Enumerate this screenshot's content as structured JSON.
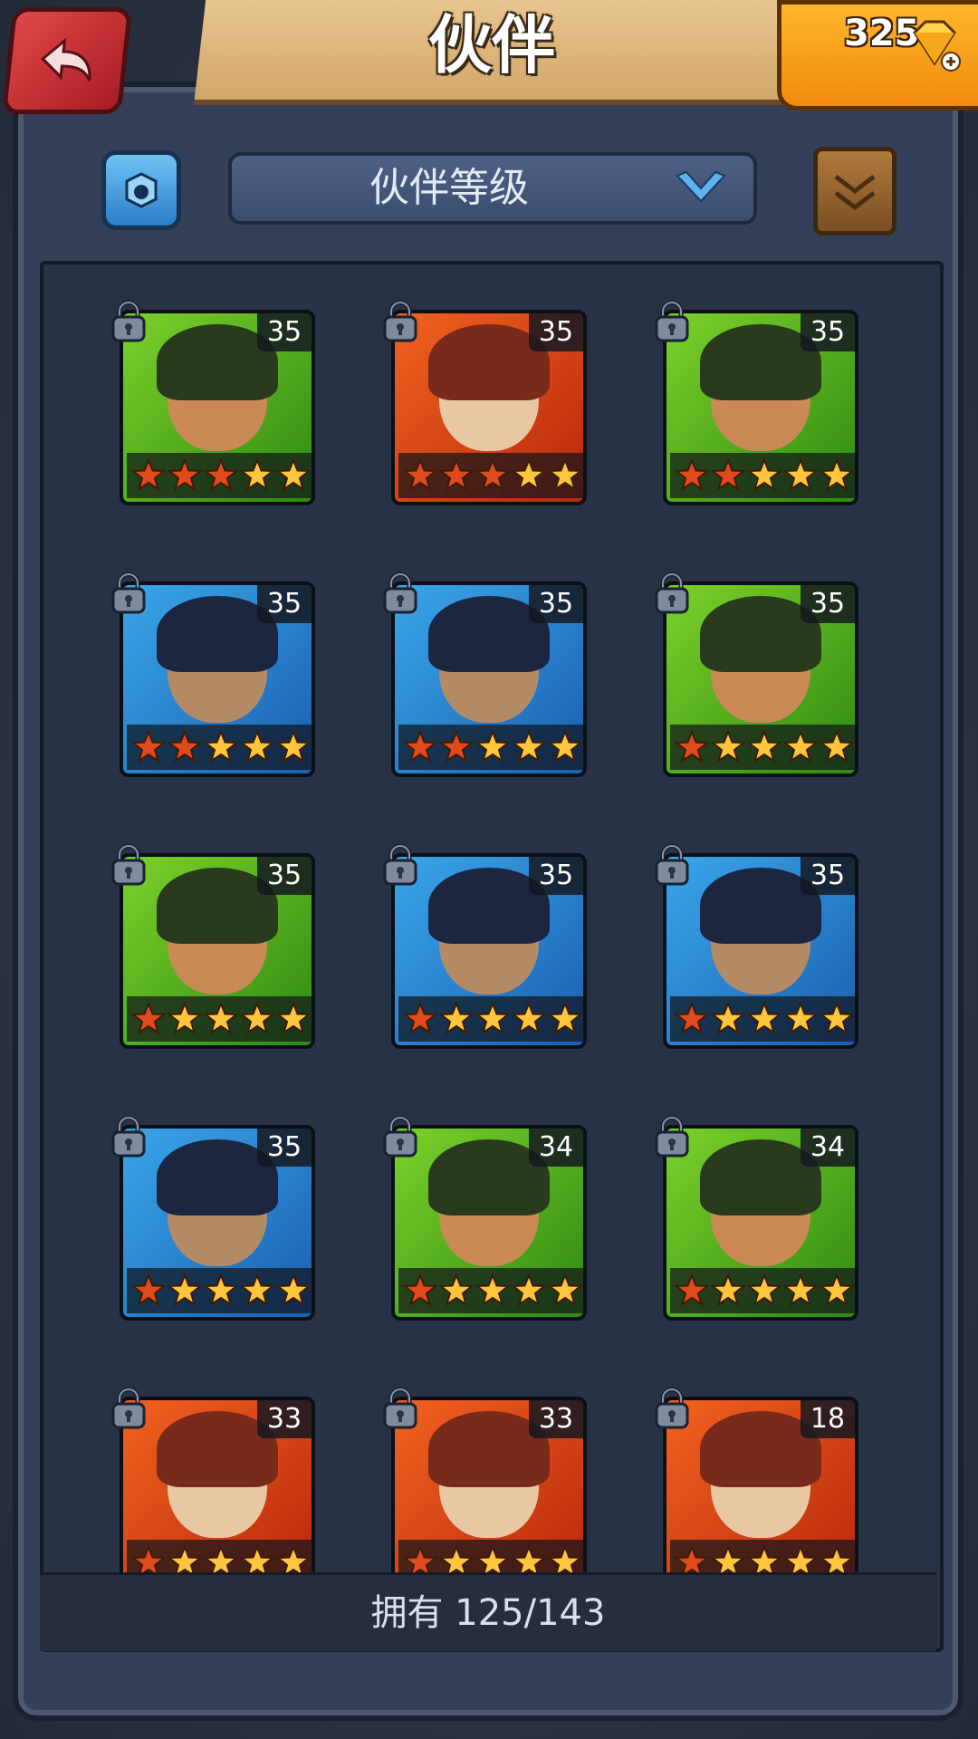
{
  "header": {
    "title": "伙伴"
  },
  "currency": {
    "gems": "325"
  },
  "toolbar": {
    "sort_label": "伙伴等级"
  },
  "footer": {
    "owned_text": "拥有 125/143"
  },
  "colors": {
    "red_star": "#e04a1c",
    "gold_star": "#ffc53d"
  },
  "partners": [
    {
      "level": "35",
      "stars_red": 3,
      "bg": "green"
    },
    {
      "level": "35",
      "stars_red": 3,
      "bg": "red"
    },
    {
      "level": "35",
      "stars_red": 2,
      "bg": "green"
    },
    {
      "level": "35",
      "stars_red": 2,
      "bg": "blue"
    },
    {
      "level": "35",
      "stars_red": 2,
      "bg": "blue"
    },
    {
      "level": "35",
      "stars_red": 1,
      "bg": "green"
    },
    {
      "level": "35",
      "stars_red": 1,
      "bg": "green"
    },
    {
      "level": "35",
      "stars_red": 1,
      "bg": "blue"
    },
    {
      "level": "35",
      "stars_red": 1,
      "bg": "blue"
    },
    {
      "level": "35",
      "stars_red": 1,
      "bg": "blue"
    },
    {
      "level": "34",
      "stars_red": 1,
      "bg": "green"
    },
    {
      "level": "34",
      "stars_red": 1,
      "bg": "green"
    },
    {
      "level": "33",
      "stars_red": 1,
      "bg": "red"
    },
    {
      "level": "33",
      "stars_red": 1,
      "bg": "red"
    },
    {
      "level": "18",
      "stars_red": 1,
      "bg": "red"
    }
  ]
}
